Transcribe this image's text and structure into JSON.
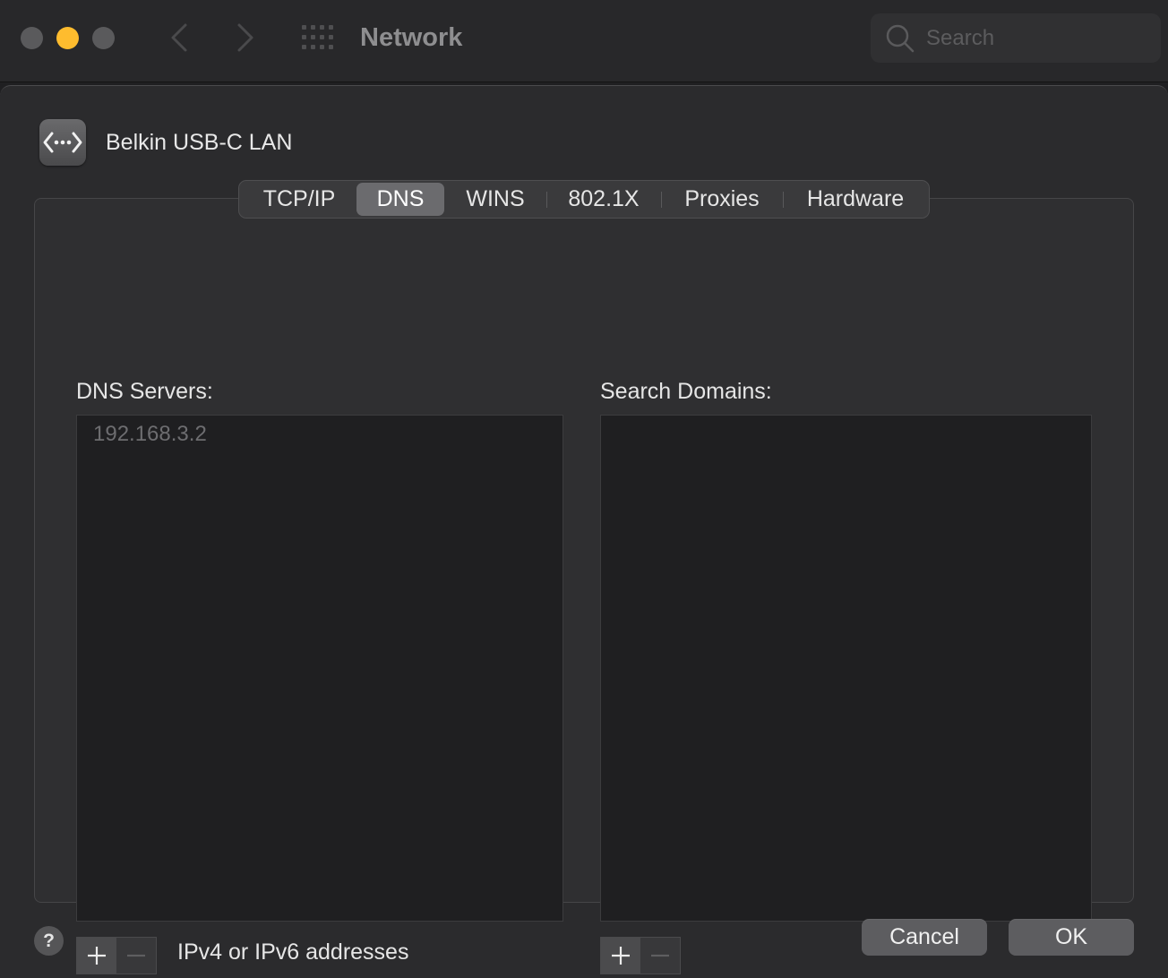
{
  "window": {
    "title": "Network",
    "search_placeholder": "Search"
  },
  "interface": {
    "name": "Belkin USB-C LAN",
    "icon": "ethernet-arrows-icon"
  },
  "tabs": [
    {
      "label": "TCP/IP",
      "active": false
    },
    {
      "label": "DNS",
      "active": true
    },
    {
      "label": "WINS",
      "active": false
    },
    {
      "label": "802.1X",
      "active": false
    },
    {
      "label": "Proxies",
      "active": false
    },
    {
      "label": "Hardware",
      "active": false
    }
  ],
  "dns_servers": {
    "label": "DNS Servers:",
    "items": [
      "192.168.3.2"
    ],
    "hint": "IPv4 or IPv6 addresses"
  },
  "search_domains": {
    "label": "Search Domains:",
    "items": []
  },
  "buttons": {
    "help": "?",
    "cancel": "Cancel",
    "ok": "OK"
  },
  "colors": {
    "minimize": "#febc2e",
    "window_bg": "#1f1f21",
    "selected_tab": "#6b6b6e"
  }
}
